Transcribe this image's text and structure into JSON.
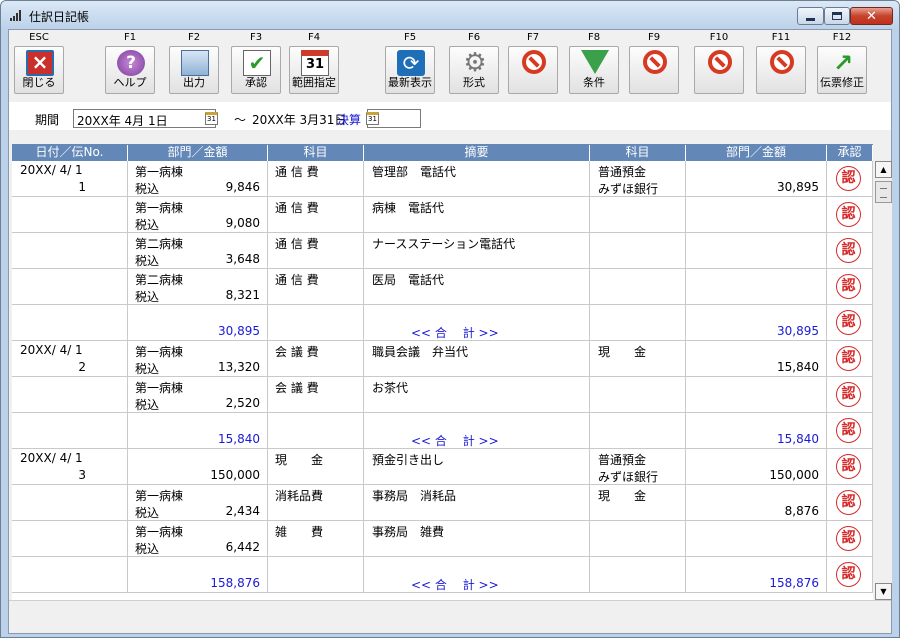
{
  "window": {
    "title": "仕訳日記帳"
  },
  "toolbar": [
    {
      "key": "ESC",
      "label": "閉じる",
      "icon": "close-icon"
    },
    {
      "key": "F1",
      "label": "ヘルプ",
      "icon": "help-icon"
    },
    {
      "key": "F2",
      "label": "出力",
      "icon": "output-icon"
    },
    {
      "key": "F3",
      "label": "承認",
      "icon": "approve-icon"
    },
    {
      "key": "F4",
      "label": "範囲指定",
      "icon": "calendar-icon"
    },
    {
      "key": "F5",
      "label": "最新表示",
      "icon": "refresh-icon"
    },
    {
      "key": "F6",
      "label": "形式",
      "icon": "gear-icon"
    },
    {
      "key": "F7",
      "label": "",
      "icon": "disabled-icon"
    },
    {
      "key": "F8",
      "label": "条件",
      "icon": "filter-icon"
    },
    {
      "key": "F9",
      "label": "",
      "icon": "disabled-icon"
    },
    {
      "key": "F10",
      "label": "",
      "icon": "disabled-icon"
    },
    {
      "key": "F11",
      "label": "",
      "icon": "disabled-icon"
    },
    {
      "key": "F12",
      "label": "伝票修正",
      "icon": "edit-voucher-icon"
    }
  ],
  "period": {
    "label": "期間",
    "start": "20XX年 4月 1日",
    "separator": "〜",
    "end": "20XX年 3月31日",
    "closing": "決算",
    "calendar_glyph": "31"
  },
  "columns": [
    "日付／伝No.",
    "部門／金額",
    "科目",
    "摘要",
    "科目",
    "部門／金額",
    "承認"
  ],
  "stamp_text": "認",
  "rows": [
    {
      "date": "20XX/ 4/ 1",
      "no": "1",
      "dept": "第一病棟",
      "tax": "税込",
      "amount": "9,846",
      "debit": "通 信 費",
      "memo": "管理部　電話代",
      "credit": "普通預金",
      "credit2": "みずほ銀行",
      "credit_amount": "30,895"
    },
    {
      "date": "",
      "no": "",
      "dept": "第一病棟",
      "tax": "税込",
      "amount": "9,080",
      "debit": "通 信 費",
      "memo": "病棟　電話代",
      "credit": "",
      "credit2": "",
      "credit_amount": ""
    },
    {
      "date": "",
      "no": "",
      "dept": "第二病棟",
      "tax": "税込",
      "amount": "3,648",
      "debit": "通 信 費",
      "memo": "ナースステーション電話代",
      "credit": "",
      "credit2": "",
      "credit_amount": ""
    },
    {
      "date": "",
      "no": "",
      "dept": "第二病棟",
      "tax": "税込",
      "amount": "8,321",
      "debit": "通 信 費",
      "memo": "医局　電話代",
      "credit": "",
      "credit2": "",
      "credit_amount": ""
    },
    {
      "total": true,
      "amount": "30,895",
      "memo": "<< 合　 計 >>",
      "credit_amount": "30,895"
    },
    {
      "date": "20XX/ 4/ 1",
      "no": "2",
      "dept": "第一病棟",
      "tax": "税込",
      "amount": "13,320",
      "debit": "会 議 費",
      "memo": "職員会議　弁当代",
      "credit": "現　　金",
      "credit2": "",
      "credit_amount": "15,840"
    },
    {
      "date": "",
      "no": "",
      "dept": "第一病棟",
      "tax": "税込",
      "amount": "2,520",
      "debit": "会 議 費",
      "memo": "お茶代",
      "credit": "",
      "credit2": "",
      "credit_amount": ""
    },
    {
      "total": true,
      "amount": "15,840",
      "memo": "<< 合　 計 >>",
      "credit_amount": "15,840"
    },
    {
      "date": "20XX/ 4/ 1",
      "no": "3",
      "dept": "",
      "tax": "",
      "amount": "150,000",
      "debit": "現　　金",
      "memo": "預金引き出し",
      "credit": "普通預金",
      "credit2": "みずほ銀行",
      "credit_amount": "150,000"
    },
    {
      "date": "",
      "no": "",
      "dept": "第一病棟",
      "tax": "税込",
      "amount": "2,434",
      "debit": "消耗品費",
      "memo": "事務局　消耗品",
      "credit": "現　　金",
      "credit2": "",
      "credit_amount": "8,876"
    },
    {
      "date": "",
      "no": "",
      "dept": "第一病棟",
      "tax": "税込",
      "amount": "6,442",
      "debit": "雑　　費",
      "memo": "事務局　雑費",
      "credit": "",
      "credit2": "",
      "credit_amount": ""
    },
    {
      "total": true,
      "amount": "158,876",
      "memo": "<< 合　 計 >>",
      "credit_amount": "158,876"
    }
  ]
}
